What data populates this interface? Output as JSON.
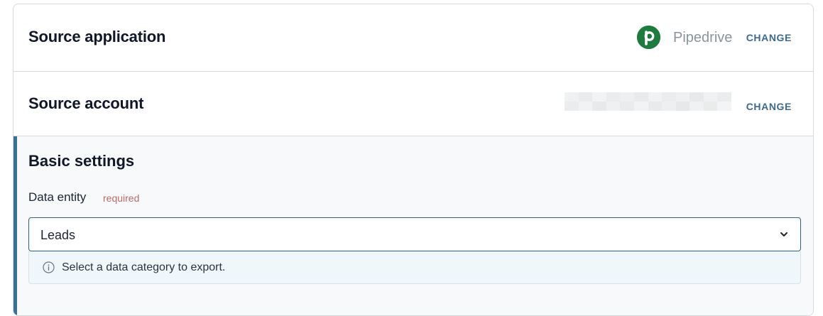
{
  "source_application": {
    "title": "Source application",
    "app_icon": "pipedrive-logo-icon",
    "app_name": "Pipedrive",
    "change_label": "CHANGE",
    "brand_color": "#1f7a3d"
  },
  "source_account": {
    "title": "Source account",
    "account_value_hidden": true,
    "change_label": "CHANGE"
  },
  "basic_settings": {
    "title": "Basic settings",
    "data_entity": {
      "label": "Data entity",
      "required_label": "required",
      "selected_value": "Leads",
      "dropdown_icon": "chevron-down-icon",
      "hint_icon": "info-icon",
      "hint_text": "Select a data category to export."
    }
  },
  "colors": {
    "accent": "#3a6f96",
    "change_link": "#3f6a8c",
    "required": "#b86a6a"
  }
}
